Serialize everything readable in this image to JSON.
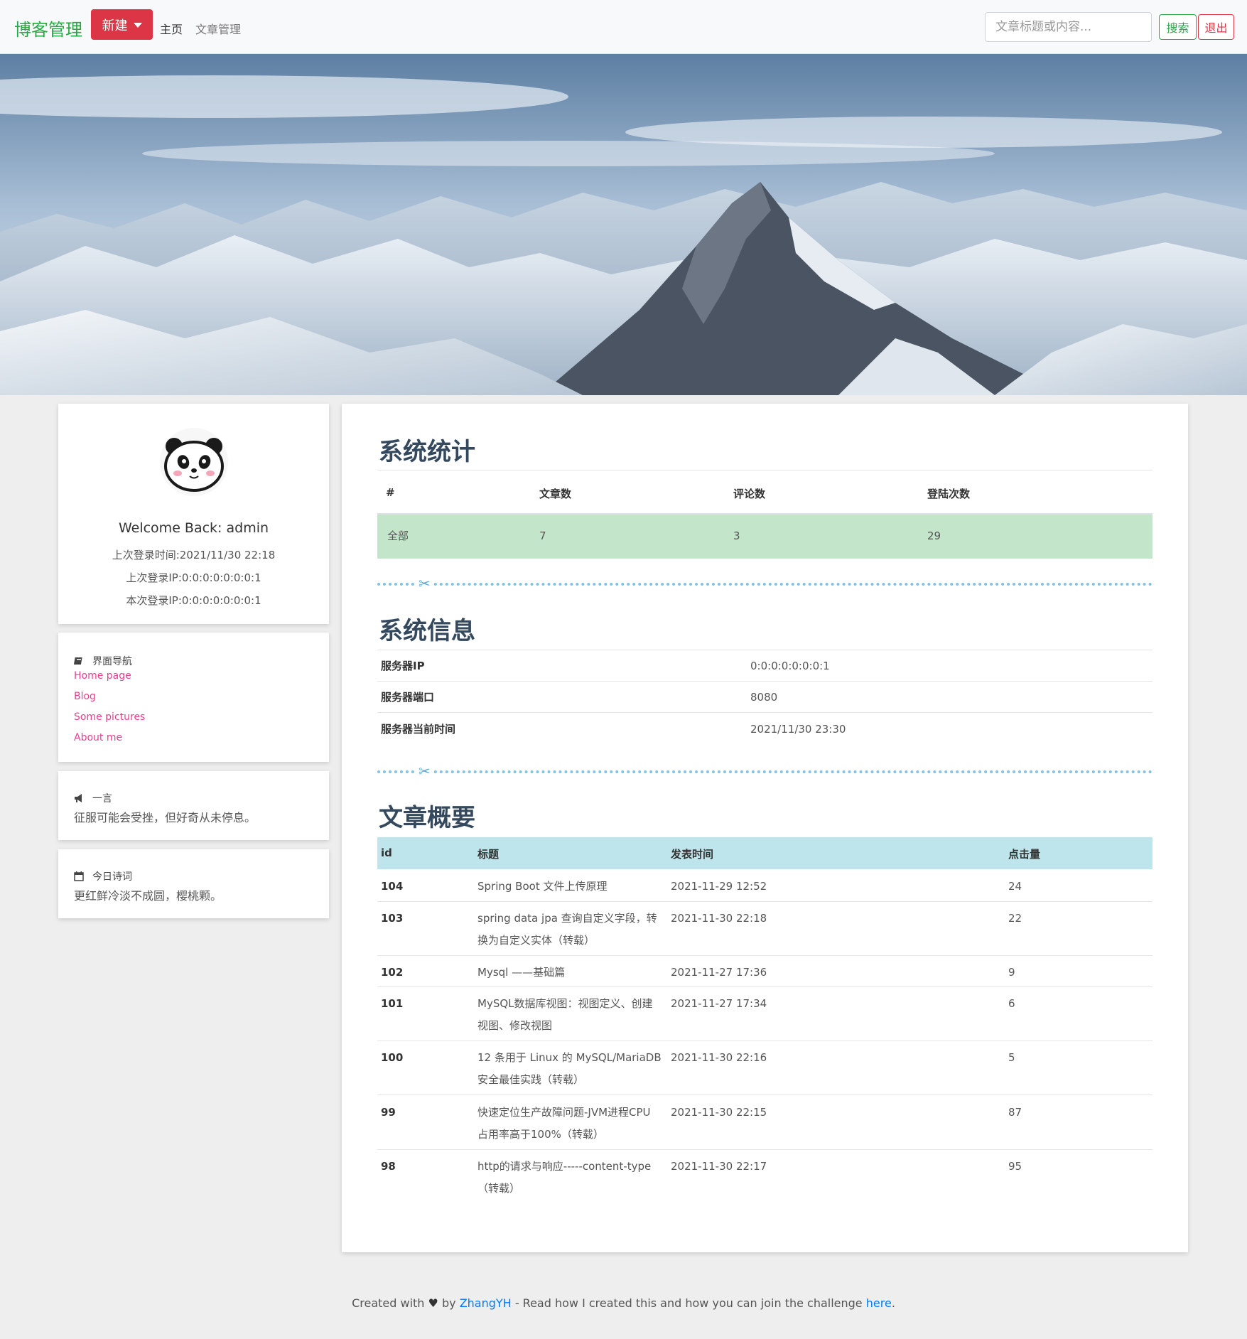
{
  "navbar": {
    "brand": "博客管理",
    "new_button": "新建",
    "home": "主页",
    "articles": "文章管理",
    "search_placeholder": "文章标题或内容...",
    "search_button": "搜索",
    "logout_button": "退出"
  },
  "profile": {
    "welcome": "Welcome Back: admin",
    "last_login_time": "上次登录时间:2021/11/30 22:18",
    "last_login_ip": "上次登录IP:0:0:0:0:0:0:0:1",
    "current_login_ip": "本次登录IP:0:0:0:0:0:0:0:1"
  },
  "sidebar_nav": {
    "title": "界面导航",
    "links": [
      "Home page",
      "Blog",
      "Some pictures",
      "About me"
    ]
  },
  "quote": {
    "title": "一言",
    "text": "征服可能会受挫，但好奇从未停息。"
  },
  "poem": {
    "title": "今日诗词",
    "text": "更红鲜冷淡不成圆，樱桃颗。"
  },
  "stats": {
    "title": "系统统计",
    "headers": [
      "#",
      "文章数",
      "评论数",
      "登陆次数"
    ],
    "row": [
      "全部",
      "7",
      "3",
      "29"
    ]
  },
  "info": {
    "title": "系统信息",
    "rows": [
      {
        "label": "服务器IP",
        "value": "0:0:0:0:0:0:0:1"
      },
      {
        "label": "服务器端口",
        "value": "8080"
      },
      {
        "label": "服务器当前时间",
        "value": "2021/11/30 23:30"
      }
    ]
  },
  "articles": {
    "title": "文章概要",
    "headers": [
      "id",
      "标题",
      "发表时间",
      "点击量"
    ],
    "rows": [
      {
        "id": "104",
        "title1": "Spring Boot 文件上传原理",
        "title2": "",
        "time": "2021-11-29 12:52",
        "clicks": "24"
      },
      {
        "id": "103",
        "title1": "spring data jpa 查询自定义字段，转",
        "title2": "换为自定义实体（转载）",
        "time": "2021-11-30 22:18",
        "clicks": "22"
      },
      {
        "id": "102",
        "title1": "Mysql ——基础篇",
        "title2": "",
        "time": "2021-11-27 17:36",
        "clicks": "9"
      },
      {
        "id": "101",
        "title1": "MySQL数据库视图：视图定义、创建",
        "title2": "视图、修改视图",
        "time": "2021-11-27 17:34",
        "clicks": "6"
      },
      {
        "id": "100",
        "title1": "12 条用于 Linux 的 MySQL/MariaDB",
        "title2": "安全最佳实践（转载）",
        "time": "2021-11-30 22:16",
        "clicks": "5"
      },
      {
        "id": "99",
        "title1": "快速定位生产故障问题-JVM进程CPU",
        "title2": "占用率高于100%（转载）",
        "time": "2021-11-30 22:15",
        "clicks": "87"
      },
      {
        "id": "98",
        "title1": "http的请求与响应-----content-type",
        "title2": "（转载）",
        "time": "2021-11-30 22:17",
        "clicks": "95"
      }
    ]
  },
  "footer": {
    "created_with": "Created with",
    "by": "by",
    "author": "ZhangYH",
    "middle": "- Read how I created this and how you can join the challenge",
    "here": "here",
    "end": "."
  },
  "colors": {
    "brand": "#28a745",
    "danger": "#dc3545",
    "link_pink": "#e83e8c",
    "success_row": "#c3e6cb",
    "info_header": "#bee5eb"
  }
}
